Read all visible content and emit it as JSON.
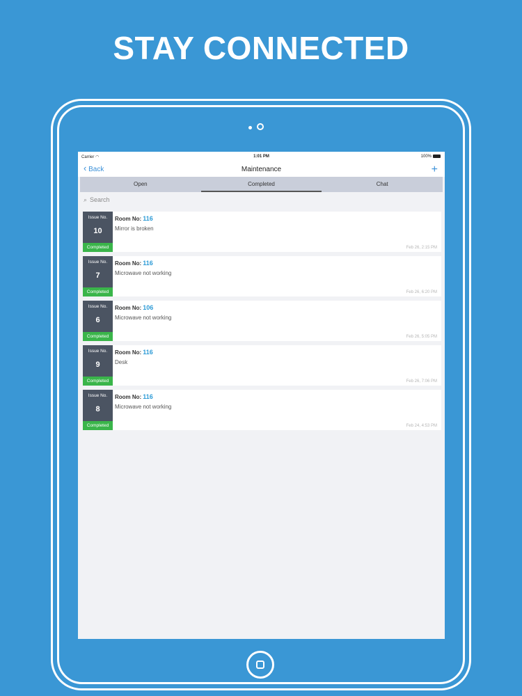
{
  "headline": "STAY CONNECTED",
  "status_bar": {
    "carrier": "Carrier",
    "time": "1:01 PM",
    "battery": "100%"
  },
  "nav": {
    "back_label": "Back",
    "title": "Maintenance",
    "add_label": "+"
  },
  "tabs": [
    {
      "label": "Open"
    },
    {
      "label": "Completed"
    },
    {
      "label": "Chat"
    }
  ],
  "search": {
    "placeholder": "Search"
  },
  "issues": [
    {
      "issue_label": "Issue No.",
      "number": "10",
      "status": "Completed",
      "room_label": "Room No:",
      "room": "116",
      "description": "Mirror is broken",
      "timestamp": "Feb 26, 2:15 PM"
    },
    {
      "issue_label": "Issue No.",
      "number": "7",
      "status": "Completed",
      "room_label": "Room No:",
      "room": "116",
      "description": "Microwave not working",
      "timestamp": "Feb 26, 6:20 PM"
    },
    {
      "issue_label": "Issue No.",
      "number": "6",
      "status": "Completed",
      "room_label": "Room No:",
      "room": "106",
      "description": "Microwave not working",
      "timestamp": "Feb 26, 5:05 PM"
    },
    {
      "issue_label": "Issue No.",
      "number": "9",
      "status": "Completed",
      "room_label": "Room No:",
      "room": "116",
      "description": "Desk",
      "timestamp": "Feb 26, 7:06 PM"
    },
    {
      "issue_label": "Issue No.",
      "number": "8",
      "status": "Completed",
      "room_label": "Room No:",
      "room": "116",
      "description": "Microwave not working",
      "timestamp": "Feb 24, 4:53 PM"
    }
  ],
  "colors": {
    "background": "#3a97d5",
    "accent": "#2e9bd6",
    "badge": "#4b5462",
    "status_green": "#3ab54a"
  }
}
